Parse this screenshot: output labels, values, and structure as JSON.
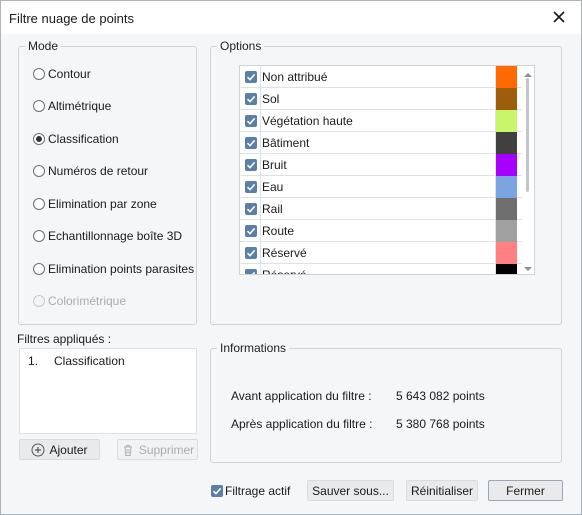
{
  "window": {
    "title": "Filtre nuage de points",
    "close_icon": "close-icon"
  },
  "mode": {
    "legend": "Mode",
    "options": [
      {
        "label": "Contour",
        "checked": false,
        "disabled": false
      },
      {
        "label": "Altimétrique",
        "checked": false,
        "disabled": false
      },
      {
        "label": "Classification",
        "checked": true,
        "disabled": false
      },
      {
        "label": "Numéros de retour",
        "checked": false,
        "disabled": false
      },
      {
        "label": "Elimination par zone",
        "checked": false,
        "disabled": false
      },
      {
        "label": "Echantillonnage boîte 3D",
        "checked": false,
        "disabled": false
      },
      {
        "label": "Elimination points parasites",
        "checked": false,
        "disabled": false
      },
      {
        "label": "Colorimétrique",
        "checked": false,
        "disabled": true
      }
    ]
  },
  "options": {
    "legend": "Options",
    "items": [
      {
        "label": "Non attribué",
        "checked": true,
        "color": "#ff6a00"
      },
      {
        "label": "Sol",
        "checked": true,
        "color": "#9c5e0a"
      },
      {
        "label": "Végétation haute",
        "checked": true,
        "color": "#c8f56a"
      },
      {
        "label": "Bâtiment",
        "checked": true,
        "color": "#404040"
      },
      {
        "label": "Bruit",
        "checked": true,
        "color": "#a800ff"
      },
      {
        "label": "Eau",
        "checked": true,
        "color": "#7aa5e0"
      },
      {
        "label": "Rail",
        "checked": true,
        "color": "#6e6e6e"
      },
      {
        "label": "Route",
        "checked": true,
        "color": "#a0a0a0"
      },
      {
        "label": "Réservé",
        "checked": true,
        "color": "#ff8080"
      },
      {
        "label": "Réservé",
        "checked": true,
        "color": "#000000"
      }
    ]
  },
  "filters": {
    "label": "Filtres appliqués :",
    "items": [
      {
        "number": "1.",
        "name": "Classification"
      }
    ],
    "add_button": "Ajouter",
    "remove_button": "Supprimer"
  },
  "information": {
    "legend": "Informations",
    "before_label": "Avant application du filtre :",
    "before_value": "5 643 082 points",
    "after_label": "Après application du filtre :",
    "after_value": "5 380 768 points"
  },
  "footer": {
    "active_filter_label": "Filtrage actif",
    "active_filter_checked": true,
    "save_as_button": "Sauver sous...",
    "reset_button": "Réinitialiser",
    "close_button": "Fermer"
  }
}
